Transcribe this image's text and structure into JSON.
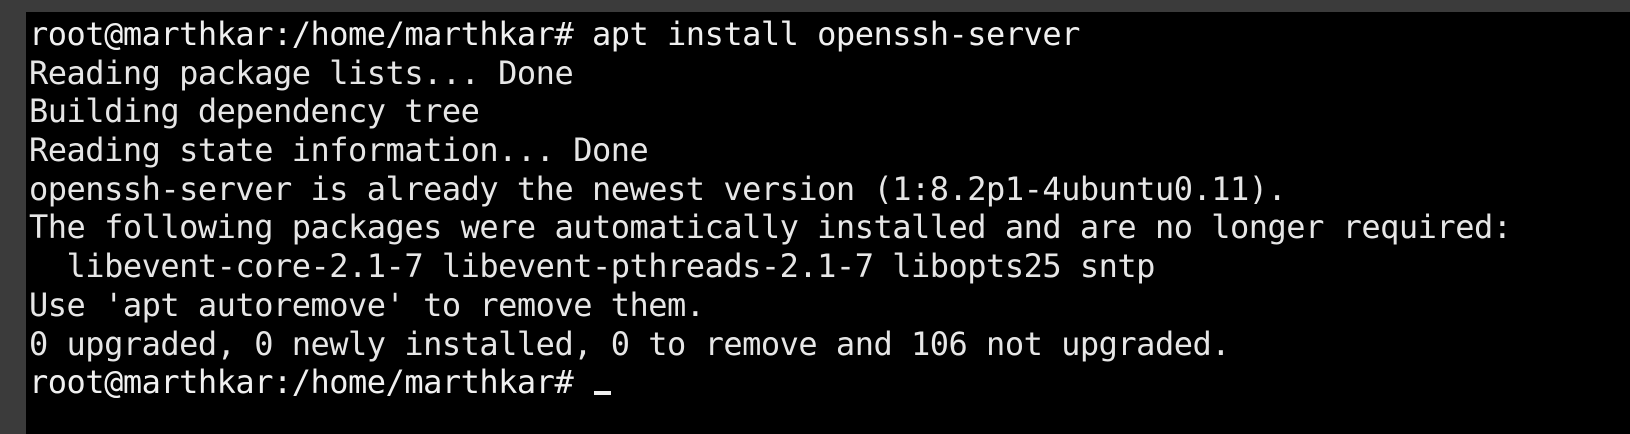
{
  "terminal": {
    "lines": [
      "root@marthkar:/home/marthkar# apt install openssh-server",
      "Reading package lists... Done",
      "Building dependency tree",
      "Reading state information... Done",
      "openssh-server is already the newest version (1:8.2p1-4ubuntu0.11).",
      "The following packages were automatically installed and are no longer required:",
      "  libevent-core-2.1-7 libevent-pthreads-2.1-7 libopts25 sntp",
      "Use 'apt autoremove' to remove them.",
      "0 upgraded, 0 newly installed, 0 to remove and 106 not upgraded."
    ],
    "prompt": "root@marthkar:/home/marthkar# ",
    "colors": {
      "background": "#000000",
      "foreground": "#e6e6e6",
      "frame": "#3b3b3b"
    }
  }
}
